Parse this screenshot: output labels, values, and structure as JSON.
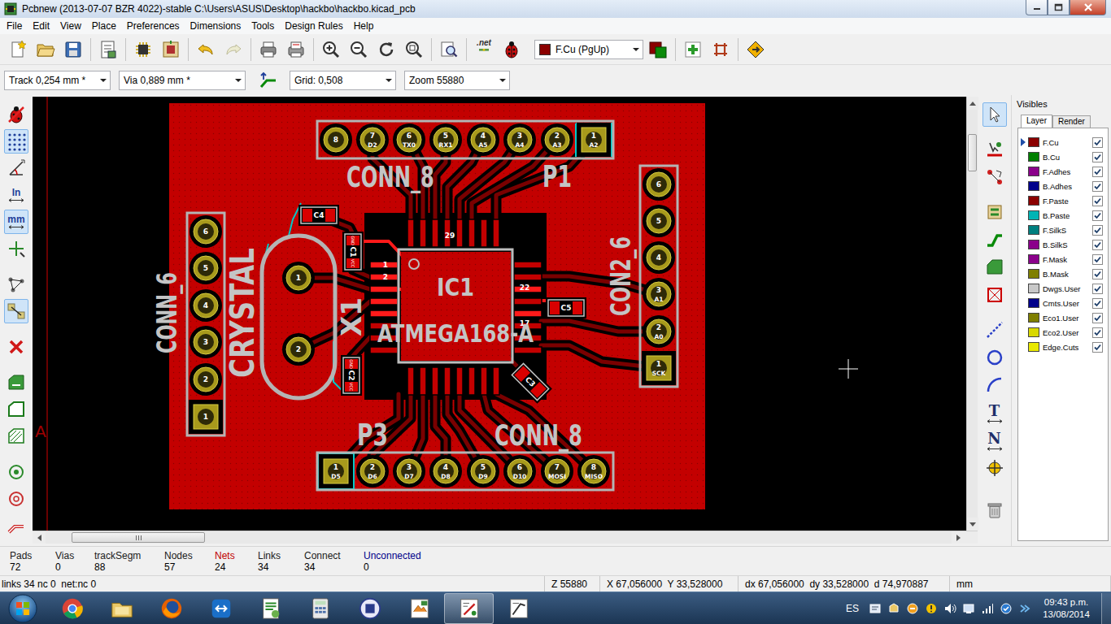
{
  "window": {
    "title": "Pcbnew (2013-07-07 BZR 4022)-stable C:\\Users\\ASUS\\Desktop\\hackbo\\hackbo.kicad_pcb"
  },
  "menu": [
    "File",
    "Edit",
    "View",
    "Place",
    "Preferences",
    "Dimensions",
    "Tools",
    "Design Rules",
    "Help"
  ],
  "toolbar": {
    "net_button": ".net",
    "layer": "F.Cu (PgUp)"
  },
  "options": {
    "track": "Track 0,254 mm *",
    "via": "Via 0,889 mm *",
    "grid": "Grid: 0,508",
    "zoom": "Zoom 55880"
  },
  "left_tools": [
    {
      "kind": "icon",
      "selected": false
    },
    {
      "kind": "icon",
      "selected": true
    },
    {
      "kind": "icon",
      "selected": false
    },
    {
      "kind": "text",
      "label": "In",
      "selected": false
    },
    {
      "kind": "text",
      "label": "mm",
      "selected": true
    },
    {
      "kind": "icon",
      "selected": false
    },
    {
      "kind": "icon",
      "selected": false
    },
    {
      "kind": "icon",
      "selected": true
    },
    {
      "kind": "icon",
      "selected": false
    },
    {
      "kind": "icon",
      "selected": false
    },
    {
      "kind": "icon",
      "selected": false
    },
    {
      "kind": "icon",
      "selected": false
    },
    {
      "kind": "icon",
      "selected": false
    },
    {
      "kind": "icon",
      "selected": false
    },
    {
      "kind": "icon",
      "selected": false
    }
  ],
  "right_tools": [
    {
      "kind": "icon",
      "selected": true
    },
    {
      "kind": "icon",
      "selected": false
    },
    {
      "kind": "icon",
      "selected": false
    },
    {
      "kind": "icon",
      "selected": false
    },
    {
      "kind": "icon",
      "selected": false
    },
    {
      "kind": "icon",
      "selected": false
    },
    {
      "kind": "icon",
      "selected": false
    },
    {
      "kind": "icon",
      "selected": false
    },
    {
      "kind": "icon",
      "selected": false
    },
    {
      "kind": "icon",
      "selected": false
    },
    {
      "kind": "text",
      "label": "T",
      "selected": false
    },
    {
      "kind": "text",
      "label": "N",
      "selected": false
    },
    {
      "kind": "icon",
      "selected": false
    },
    {
      "kind": "icon",
      "selected": false
    }
  ],
  "visibles": {
    "title": "Visibles",
    "tabs": [
      {
        "label": "Layer",
        "selected": true
      },
      {
        "label": "Render",
        "selected": false
      }
    ],
    "layers": [
      {
        "name": "F.Cu",
        "color": "#8b0000",
        "checked": true,
        "selected": true
      },
      {
        "name": "B.Cu",
        "color": "#007f00",
        "checked": true,
        "selected": false
      },
      {
        "name": "F.Adhes",
        "color": "#8b008b",
        "checked": true,
        "selected": false
      },
      {
        "name": "B.Adhes",
        "color": "#00008b",
        "checked": true,
        "selected": false
      },
      {
        "name": "F.Paste",
        "color": "#8b0000",
        "checked": true,
        "selected": false
      },
      {
        "name": "B.Paste",
        "color": "#00b4b4",
        "checked": true,
        "selected": false
      },
      {
        "name": "F.SilkS",
        "color": "#007f7f",
        "checked": true,
        "selected": false
      },
      {
        "name": "B.SilkS",
        "color": "#8b008b",
        "checked": true,
        "selected": false
      },
      {
        "name": "F.Mask",
        "color": "#8b008b",
        "checked": true,
        "selected": false
      },
      {
        "name": "B.Mask",
        "color": "#7f7f00",
        "checked": true,
        "selected": false
      },
      {
        "name": "Dwgs.User",
        "color": "#c8c8c8",
        "checked": true,
        "selected": false
      },
      {
        "name": "Cmts.User",
        "color": "#00008b",
        "checked": true,
        "selected": false
      },
      {
        "name": "Eco1.User",
        "color": "#7f7f00",
        "checked": true,
        "selected": false
      },
      {
        "name": "Eco2.User",
        "color": "#d8d800",
        "checked": true,
        "selected": false
      },
      {
        "name": "Edge.Cuts",
        "color": "#e8e800",
        "checked": true,
        "selected": false
      }
    ]
  },
  "board": {
    "border_mark": "A",
    "connectors": [
      {
        "ref": "P1",
        "value": "CONN_8",
        "pins": [
          {
            "num": "8"
          },
          {
            "num": "7",
            "net": "D2"
          },
          {
            "num": "6",
            "net": "TX0"
          },
          {
            "num": "5",
            "net": "RX1"
          },
          {
            "num": "4",
            "net": "A5"
          },
          {
            "num": "3",
            "net": "A4"
          },
          {
            "num": "2",
            "net": "A3"
          },
          {
            "num": "1",
            "net": "A2"
          }
        ]
      },
      {
        "ref": "P3",
        "value": "CONN_8",
        "pins": [
          {
            "num": "1",
            "net": "D5"
          },
          {
            "num": "2",
            "net": "D6"
          },
          {
            "num": "3",
            "net": "D7"
          },
          {
            "num": "4",
            "net": "D8"
          },
          {
            "num": "5",
            "net": "D9"
          },
          {
            "num": "6",
            "net": "D10"
          },
          {
            "num": "7",
            "net": "MOSI"
          },
          {
            "num": "8",
            "net": "MISO"
          }
        ]
      },
      {
        "value": "CON2_6",
        "pins": [
          {
            "num": "6"
          },
          {
            "num": "5"
          },
          {
            "num": "4"
          },
          {
            "num": "3",
            "net": "A1"
          },
          {
            "num": "2",
            "net": "A0"
          },
          {
            "num": "1",
            "net": "SCK"
          }
        ]
      },
      {
        "value": "CONN_6",
        "pins": [
          {
            "num": "6"
          },
          {
            "num": "5"
          },
          {
            "num": "4"
          },
          {
            "num": "3"
          },
          {
            "num": "2"
          },
          {
            "num": "1"
          }
        ]
      }
    ],
    "crystal": {
      "ref": "X1",
      "value": "CRYSTAL",
      "pins": [
        "1",
        "2"
      ]
    },
    "ic": {
      "ref": "IC1",
      "value": "ATMEGA168-A",
      "pins": [
        "1",
        "2",
        "22",
        "17",
        "29"
      ]
    },
    "capacitors": [
      {
        "ref": "C4"
      },
      {
        "ref": "C1",
        "pads": [
          "GND",
          "VCC"
        ]
      },
      {
        "ref": "C2",
        "pads": [
          "GND",
          "VCC"
        ]
      },
      {
        "ref": "C5"
      },
      {
        "ref": "C3"
      }
    ]
  },
  "counters": [
    {
      "label": "Pads",
      "value": "72",
      "color": "#1a1a1a"
    },
    {
      "label": "Vias",
      "value": "0",
      "color": "#1a1a1a"
    },
    {
      "label": "trackSegm",
      "value": "88",
      "color": "#1a1a1a"
    },
    {
      "label": "Nodes",
      "value": "57",
      "color": "#1a1a1a"
    },
    {
      "label": "Nets",
      "value": "24",
      "color": "#c00000"
    },
    {
      "label": "Links",
      "value": "34",
      "color": "#1a1a1a"
    },
    {
      "label": "Connect",
      "value": "34",
      "color": "#1a1a1a"
    },
    {
      "label": "Unconnected",
      "value": "0",
      "color": "#00008b"
    }
  ],
  "status": [
    "links 34 nc 0  net:nc 0",
    "Z 55880",
    "X 67,056000  Y 33,528000",
    "dx 67,056000  dy 33,528000  d 74,970887",
    "mm"
  ],
  "taskbar": {
    "apps": [
      {
        "selected": false
      },
      {
        "selected": false
      },
      {
        "selected": false
      },
      {
        "selected": false
      },
      {
        "selected": false
      },
      {
        "selected": false
      },
      {
        "selected": false
      },
      {
        "selected": false
      },
      {
        "selected": true
      },
      {
        "selected": false
      }
    ],
    "lang": "ES",
    "time": "09:43 p.m.",
    "date": "13/08/2014"
  }
}
